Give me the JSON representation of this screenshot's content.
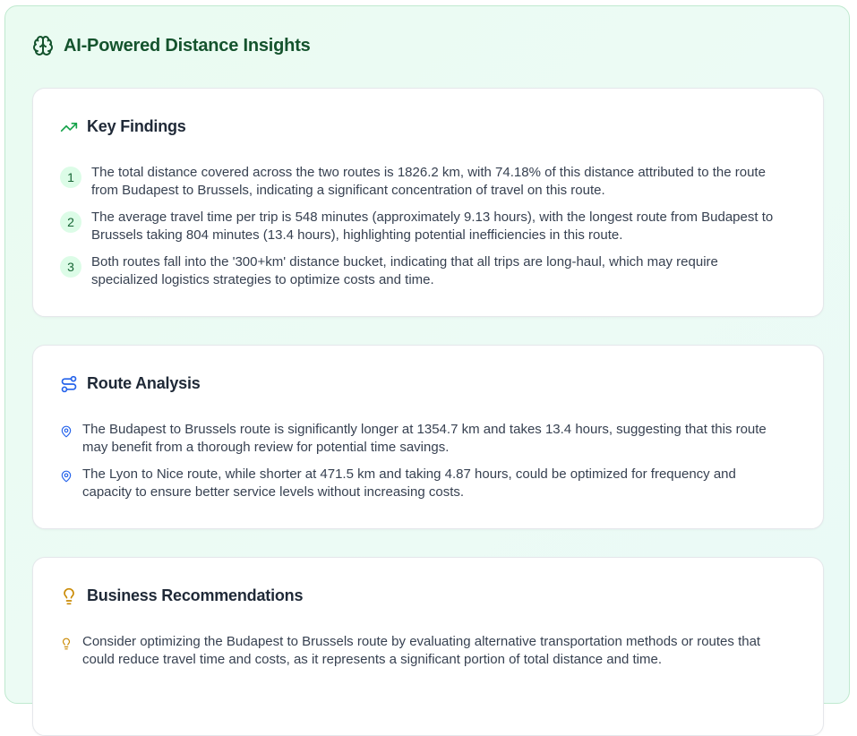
{
  "panel": {
    "title": "AI-Powered Distance Insights",
    "icon": "brain-icon",
    "accent_color": "#16a34a"
  },
  "key_findings": {
    "title": "Key Findings",
    "icon": "trending-up-icon",
    "items": [
      {
        "number": "1",
        "text": "The total distance covered across the two routes is 1826.2 km, with 74.18% of this distance attributed to the route from Budapest to Brussels, indicating a significant concentration of travel on this route."
      },
      {
        "number": "2",
        "text": "The average travel time per trip is 548 minutes (approximately 9.13 hours), with the longest route from Budapest to Brussels taking 804 minutes (13.4 hours), highlighting potential inefficiencies in this route."
      },
      {
        "number": "3",
        "text": "Both routes fall into the '300+km' distance bucket, indicating that all trips are long-haul, which may require specialized logistics strategies to optimize costs and time."
      }
    ]
  },
  "route_analysis": {
    "title": "Route Analysis",
    "icon": "route-icon",
    "item_icon": "map-pin-icon",
    "items": [
      {
        "text": "The Budapest to Brussels route is significantly longer at 1354.7 km and takes 13.4 hours, suggesting that this route may benefit from a thorough review for potential time savings."
      },
      {
        "text": "The Lyon to Nice route, while shorter at 471.5 km and taking 4.87 hours, could be optimized for frequency and capacity to ensure better service levels without increasing costs."
      }
    ]
  },
  "business_recommendations": {
    "title": "Business Recommendations",
    "icon": "lightbulb-icon",
    "item_icon": "lightbulb-icon",
    "items": [
      {
        "text": "Consider optimizing the Budapest to Brussels route by evaluating alternative transportation methods or routes that could reduce travel time and costs, as it represents a significant portion of total distance and time."
      }
    ]
  }
}
